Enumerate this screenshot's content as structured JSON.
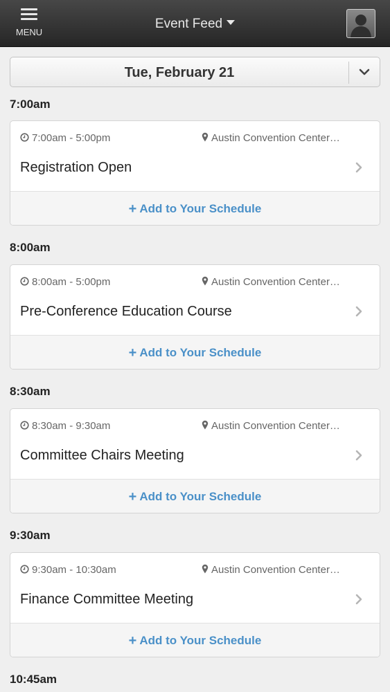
{
  "header": {
    "menu_label": "MENU",
    "title": "Event Feed"
  },
  "date_picker": {
    "label": "Tue, February 21"
  },
  "time_groups": [
    {
      "time": "7:00am"
    },
    {
      "time": "8:00am"
    },
    {
      "time": "8:30am"
    },
    {
      "time": "9:30am"
    },
    {
      "time": "10:45am"
    }
  ],
  "events": [
    {
      "time_range": "7:00am - 5:00pm",
      "location": "Austin Convention Center…",
      "title": "Registration Open",
      "action_label": "Add to Your Schedule"
    },
    {
      "time_range": "8:00am - 5:00pm",
      "location": "Austin Convention Center…",
      "title": "Pre-Conference Education Course",
      "action_label": "Add to Your Schedule"
    },
    {
      "time_range": "8:30am - 9:30am",
      "location": "Austin Convention Center…",
      "title": "Committee Chairs Meeting",
      "action_label": "Add to Your Schedule"
    },
    {
      "time_range": "9:30am - 10:30am",
      "location": "Austin Convention Center…",
      "title": "Finance Committee Meeting",
      "action_label": "Add to Your Schedule"
    }
  ],
  "icons": {
    "menu": "hamburger-icon",
    "title_caret": "caret-down-icon",
    "profile": "user-avatar-icon",
    "date_toggle": "chevron-down-icon",
    "time": "clock-icon",
    "location": "map-pin-icon",
    "open_event": "chevron-right-icon",
    "add": "plus-icon"
  },
  "colors": {
    "header_bg": "#333333",
    "page_bg": "#efefef",
    "action_text": "#4a90c8"
  }
}
